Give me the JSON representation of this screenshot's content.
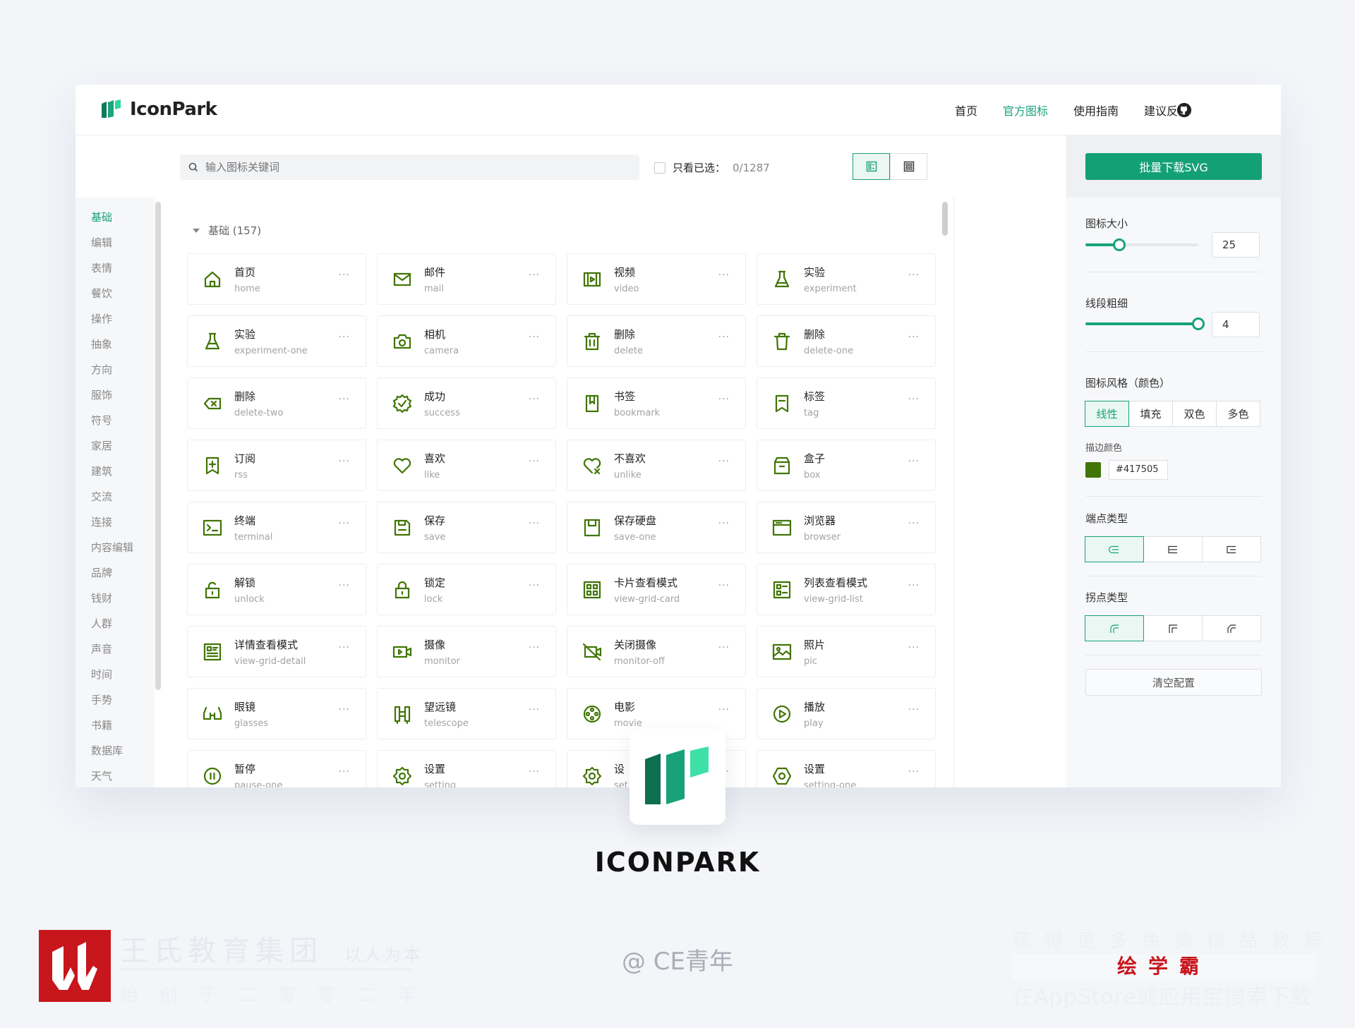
{
  "brand": {
    "name": "IconPark",
    "accent": "#19a27a",
    "icon_color": "#417505"
  },
  "nav": {
    "items": [
      "首页",
      "官方图标",
      "使用指南",
      "建议反馈"
    ],
    "active": "官方图标",
    "github_icon": "github-icon"
  },
  "toolbar": {
    "search_placeholder": "输入图标关键词",
    "only_selected_label": "只看已选：",
    "selected_count": "0/1287",
    "view_modes": [
      "list-view-icon",
      "grid-view-icon"
    ],
    "active_view": "list-view-icon"
  },
  "sidebar": {
    "items": [
      "基础",
      "编辑",
      "表情",
      "餐饮",
      "操作",
      "抽象",
      "方向",
      "服饰",
      "符号",
      "家居",
      "建筑",
      "交流",
      "连接",
      "内容编辑",
      "品牌",
      "钱财",
      "人群",
      "声音",
      "时间",
      "手势",
      "书籍",
      "数据库",
      "天气"
    ],
    "active": "基础"
  },
  "section": {
    "title": "基础 (157)"
  },
  "icons": [
    {
      "cn": "首页",
      "en": "home",
      "icon": "home-icon"
    },
    {
      "cn": "邮件",
      "en": "mail",
      "icon": "mail-icon"
    },
    {
      "cn": "视频",
      "en": "video",
      "icon": "video-icon"
    },
    {
      "cn": "实验",
      "en": "experiment",
      "icon": "experiment-icon"
    },
    {
      "cn": "实验",
      "en": "experiment-one",
      "icon": "experiment-one-icon"
    },
    {
      "cn": "相机",
      "en": "camera",
      "icon": "camera-icon"
    },
    {
      "cn": "删除",
      "en": "delete",
      "icon": "delete-icon"
    },
    {
      "cn": "删除",
      "en": "delete-one",
      "icon": "delete-one-icon"
    },
    {
      "cn": "删除",
      "en": "delete-two",
      "icon": "delete-two-icon"
    },
    {
      "cn": "成功",
      "en": "success",
      "icon": "success-icon"
    },
    {
      "cn": "书签",
      "en": "bookmark",
      "icon": "bookmark-icon"
    },
    {
      "cn": "标签",
      "en": "tag",
      "icon": "tag-icon"
    },
    {
      "cn": "订阅",
      "en": "rss",
      "icon": "rss-icon"
    },
    {
      "cn": "喜欢",
      "en": "like",
      "icon": "like-icon"
    },
    {
      "cn": "不喜欢",
      "en": "unlike",
      "icon": "unlike-icon"
    },
    {
      "cn": "盒子",
      "en": "box",
      "icon": "box-icon"
    },
    {
      "cn": "终端",
      "en": "terminal",
      "icon": "terminal-icon"
    },
    {
      "cn": "保存",
      "en": "save",
      "icon": "save-icon"
    },
    {
      "cn": "保存硬盘",
      "en": "save-one",
      "icon": "save-one-icon"
    },
    {
      "cn": "浏览器",
      "en": "browser",
      "icon": "browser-icon"
    },
    {
      "cn": "解锁",
      "en": "unlock",
      "icon": "unlock-icon"
    },
    {
      "cn": "锁定",
      "en": "lock",
      "icon": "lock-icon"
    },
    {
      "cn": "卡片查看模式",
      "en": "view-grid-card",
      "icon": "view-grid-card-icon"
    },
    {
      "cn": "列表查看模式",
      "en": "view-grid-list",
      "icon": "view-grid-list-icon"
    },
    {
      "cn": "详情查看模式",
      "en": "view-grid-detail",
      "icon": "view-grid-detail-icon"
    },
    {
      "cn": "摄像",
      "en": "monitor",
      "icon": "monitor-icon"
    },
    {
      "cn": "关闭摄像",
      "en": "monitor-off",
      "icon": "monitor-off-icon"
    },
    {
      "cn": "照片",
      "en": "pic",
      "icon": "pic-icon"
    },
    {
      "cn": "眼镜",
      "en": "glasses",
      "icon": "glasses-icon"
    },
    {
      "cn": "望远镜",
      "en": "telescope",
      "icon": "telescope-icon"
    },
    {
      "cn": "电影",
      "en": "movie",
      "icon": "movie-icon"
    },
    {
      "cn": "播放",
      "en": "play",
      "icon": "play-icon"
    },
    {
      "cn": "暂停",
      "en": "pause-one",
      "icon": "pause-one-icon"
    },
    {
      "cn": "设置",
      "en": "setting",
      "icon": "setting-icon"
    },
    {
      "cn": "设",
      "en": "set",
      "icon": "setting-two-icon"
    },
    {
      "cn": "设置",
      "en": "setting-one",
      "icon": "setting-one-icon"
    }
  ],
  "card_more": "···",
  "panel": {
    "download_label": "批量下载SVG",
    "size_label": "图标大小",
    "size_value": "25",
    "size_fraction": 0.3,
    "stroke_label": "线段粗细",
    "stroke_value": "4",
    "stroke_fraction": 1.0,
    "style_label": "图标风格（颜色）",
    "styles": [
      "线性",
      "填充",
      "双色",
      "多色"
    ],
    "active_style": "线性",
    "stroke_color_label": "描边颜色",
    "stroke_color": "#417505",
    "linecap_label": "端点类型",
    "linecaps": [
      "linecap-round-icon",
      "linecap-butt-icon",
      "linecap-square-icon"
    ],
    "linejoin_label": "拐点类型",
    "linejoins": [
      "linejoin-round-icon",
      "linejoin-miter-icon",
      "linejoin-bevel-icon"
    ],
    "reset_label": "清空配置"
  },
  "showcase": {
    "title": "ICONPARK",
    "credit": "@ CE青年"
  },
  "watermark": {
    "left_line1": "王氏教育集团",
    "left_tagline": "以人为本",
    "left_line2": "始创于二零零二年",
    "right_line1": "获得更多免费精品教程",
    "right_brand": "绘学霸",
    "right_line3": "在AppStore或应用宝搜索下载"
  }
}
